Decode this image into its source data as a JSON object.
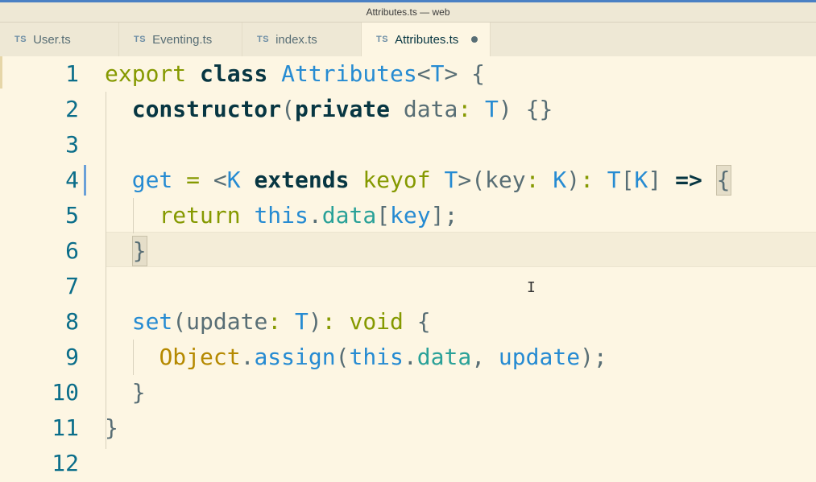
{
  "window": {
    "title": "Attributes.ts — web"
  },
  "tabs": [
    {
      "lang": "TS",
      "label": "User.ts"
    },
    {
      "lang": "TS",
      "label": "Eventing.ts"
    },
    {
      "lang": "TS",
      "label": "index.ts"
    },
    {
      "lang": "TS",
      "label": "Attributes.ts",
      "modified": true
    }
  ],
  "editor": {
    "line_numbers": [
      "1",
      "2",
      "3",
      "4",
      "5",
      "6",
      "7",
      "8",
      "9",
      "10",
      "11",
      "12"
    ],
    "lines": [
      "export class Attributes<T> {",
      "  constructor(private data: T) {}",
      "",
      "  get = <K extends keyof T>(key: K): T[K] => {",
      "    return this.data[key];",
      "  }",
      "",
      "  set(update: T): void {",
      "    Object.assign(this.data, update);",
      "  }",
      "}",
      ""
    ]
  },
  "colors": {
    "background": "#fdf6e3",
    "keyword": "#859900",
    "type": "#268bd2",
    "line_number": "#0b6e8a"
  }
}
